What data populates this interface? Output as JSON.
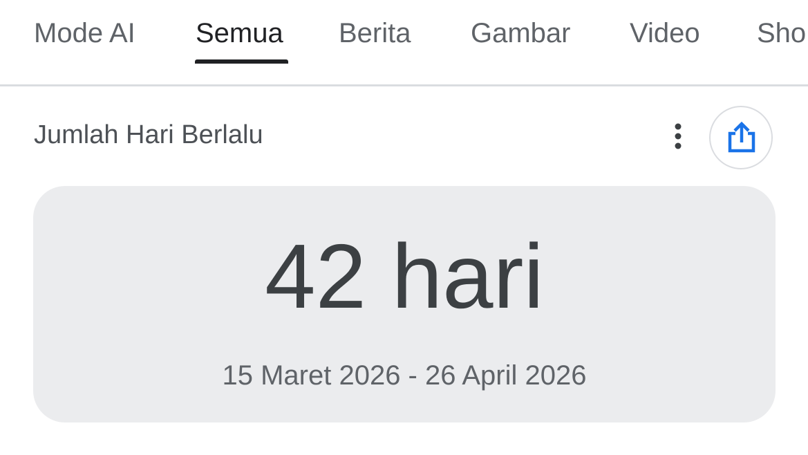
{
  "tabs": [
    {
      "label": "Mode AI",
      "active": false
    },
    {
      "label": "Semua",
      "active": true
    },
    {
      "label": "Berita",
      "active": false
    },
    {
      "label": "Gambar",
      "active": false
    },
    {
      "label": "Video",
      "active": false
    },
    {
      "label": "Sho",
      "active": false
    }
  ],
  "card": {
    "title": "Jumlah Hari Berlalu",
    "more_icon": "more-vert-icon",
    "share_icon": "share-icon",
    "result": "42 hari",
    "date_range": "15 Maret 2026 - 26 April 2026"
  },
  "colors": {
    "accent": "#1a73e8",
    "active_tab": "#202124",
    "inactive_tab": "#5f6368",
    "result_bg": "#ebecee"
  }
}
